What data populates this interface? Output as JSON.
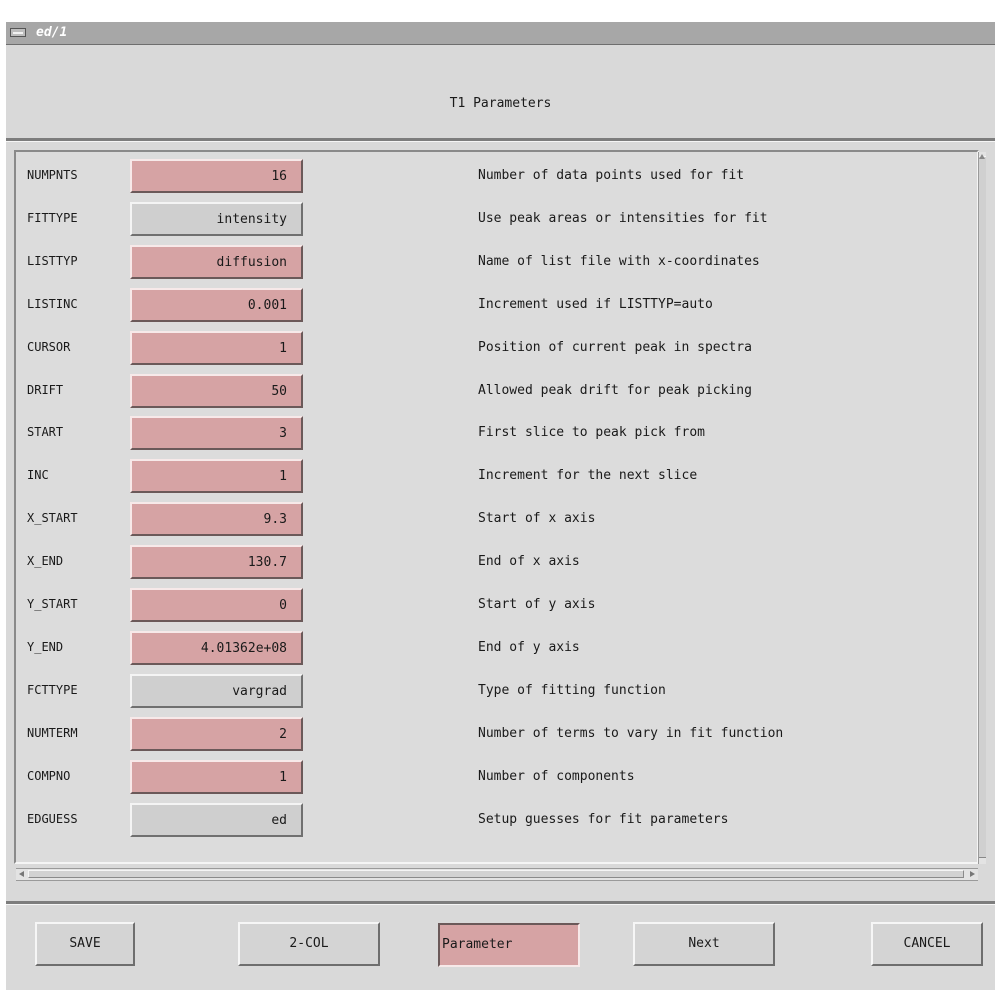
{
  "window": {
    "title": "ed/1"
  },
  "header": {
    "title": "T1 Parameters"
  },
  "params": [
    {
      "name": "NUMPNTS",
      "value": "16",
      "kind": "text",
      "desc": "Number of data points used for fit"
    },
    {
      "name": "FITTYPE",
      "value": "intensity",
      "kind": "menu",
      "desc": "Use peak areas or intensities for fit"
    },
    {
      "name": "LISTTYP",
      "value": "diffusion",
      "kind": "text",
      "desc": "Name of list file with x-coordinates"
    },
    {
      "name": "LISTINC",
      "value": "0.001",
      "kind": "text",
      "desc": "Increment used if LISTTYP=auto"
    },
    {
      "name": "CURSOR",
      "value": "1",
      "kind": "text",
      "desc": "Position of current peak in spectra"
    },
    {
      "name": "DRIFT",
      "value": "50",
      "kind": "text",
      "desc": "Allowed peak drift for peak picking"
    },
    {
      "name": "START",
      "value": "3",
      "kind": "text",
      "desc": "First slice to peak pick from"
    },
    {
      "name": "INC",
      "value": "1",
      "kind": "text",
      "desc": "Increment for the next slice"
    },
    {
      "name": "X_START",
      "value": "9.3",
      "kind": "text",
      "desc": "Start of x axis"
    },
    {
      "name": "X_END",
      "value": "130.7",
      "kind": "text",
      "desc": "End of x axis"
    },
    {
      "name": "Y_START",
      "value": "0",
      "kind": "text",
      "desc": "Start of y axis"
    },
    {
      "name": "Y_END",
      "value": "4.01362e+08",
      "kind": "text",
      "desc": "End of y axis"
    },
    {
      "name": "FCTTYPE",
      "value": "vargrad",
      "kind": "menu",
      "desc": "Type of fitting function"
    },
    {
      "name": "NUMTERM",
      "value": "2",
      "kind": "text",
      "desc": "Number of terms to vary in fit function"
    },
    {
      "name": "COMPNO",
      "value": "1",
      "kind": "text",
      "desc": "Number of components"
    },
    {
      "name": "EDGUESS",
      "value": "ed",
      "kind": "menu",
      "desc": "Setup guesses for fit parameters"
    }
  ],
  "buttons": {
    "save": "SAVE",
    "two_col": "2-COL",
    "parameter": "Parameter",
    "next": "Next",
    "cancel": "CANCEL"
  },
  "colors": {
    "text_field": "#d6a3a4",
    "menu_button": "#cfcfcf",
    "background": "#d9d9d9"
  }
}
